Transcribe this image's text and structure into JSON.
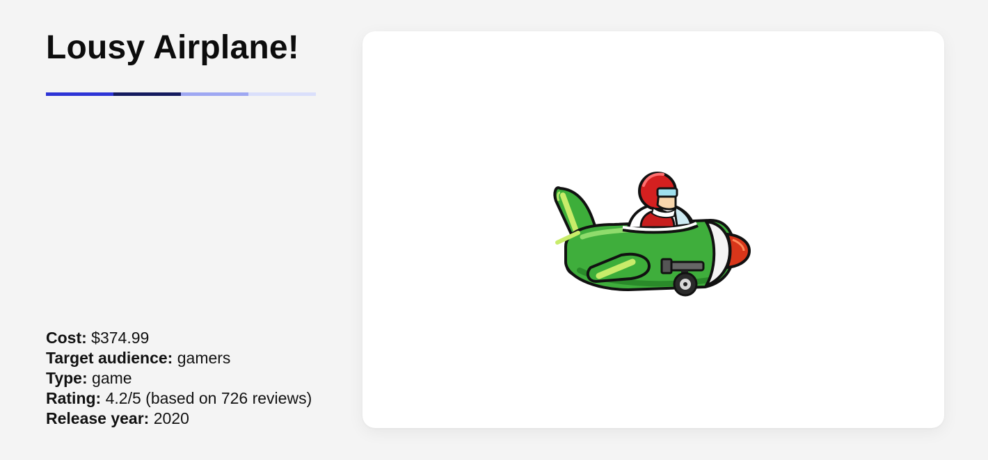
{
  "product": {
    "title": "Lousy Airplane!",
    "accent_colors": [
      "#2d34d6",
      "#141a5e",
      "#9ea7f2",
      "#dadffb"
    ],
    "image_description_icon": "cartoon-airplane-icon"
  },
  "details": [
    {
      "label": "Cost:",
      "value": " $374.99"
    },
    {
      "label": "Target audience:",
      "value": " gamers"
    },
    {
      "label": "Type:",
      "value": " game"
    },
    {
      "label": "Rating:",
      "value": " 4.2/5 (based on 726 reviews)"
    },
    {
      "label": "Release year:",
      "value": " 2020"
    }
  ]
}
